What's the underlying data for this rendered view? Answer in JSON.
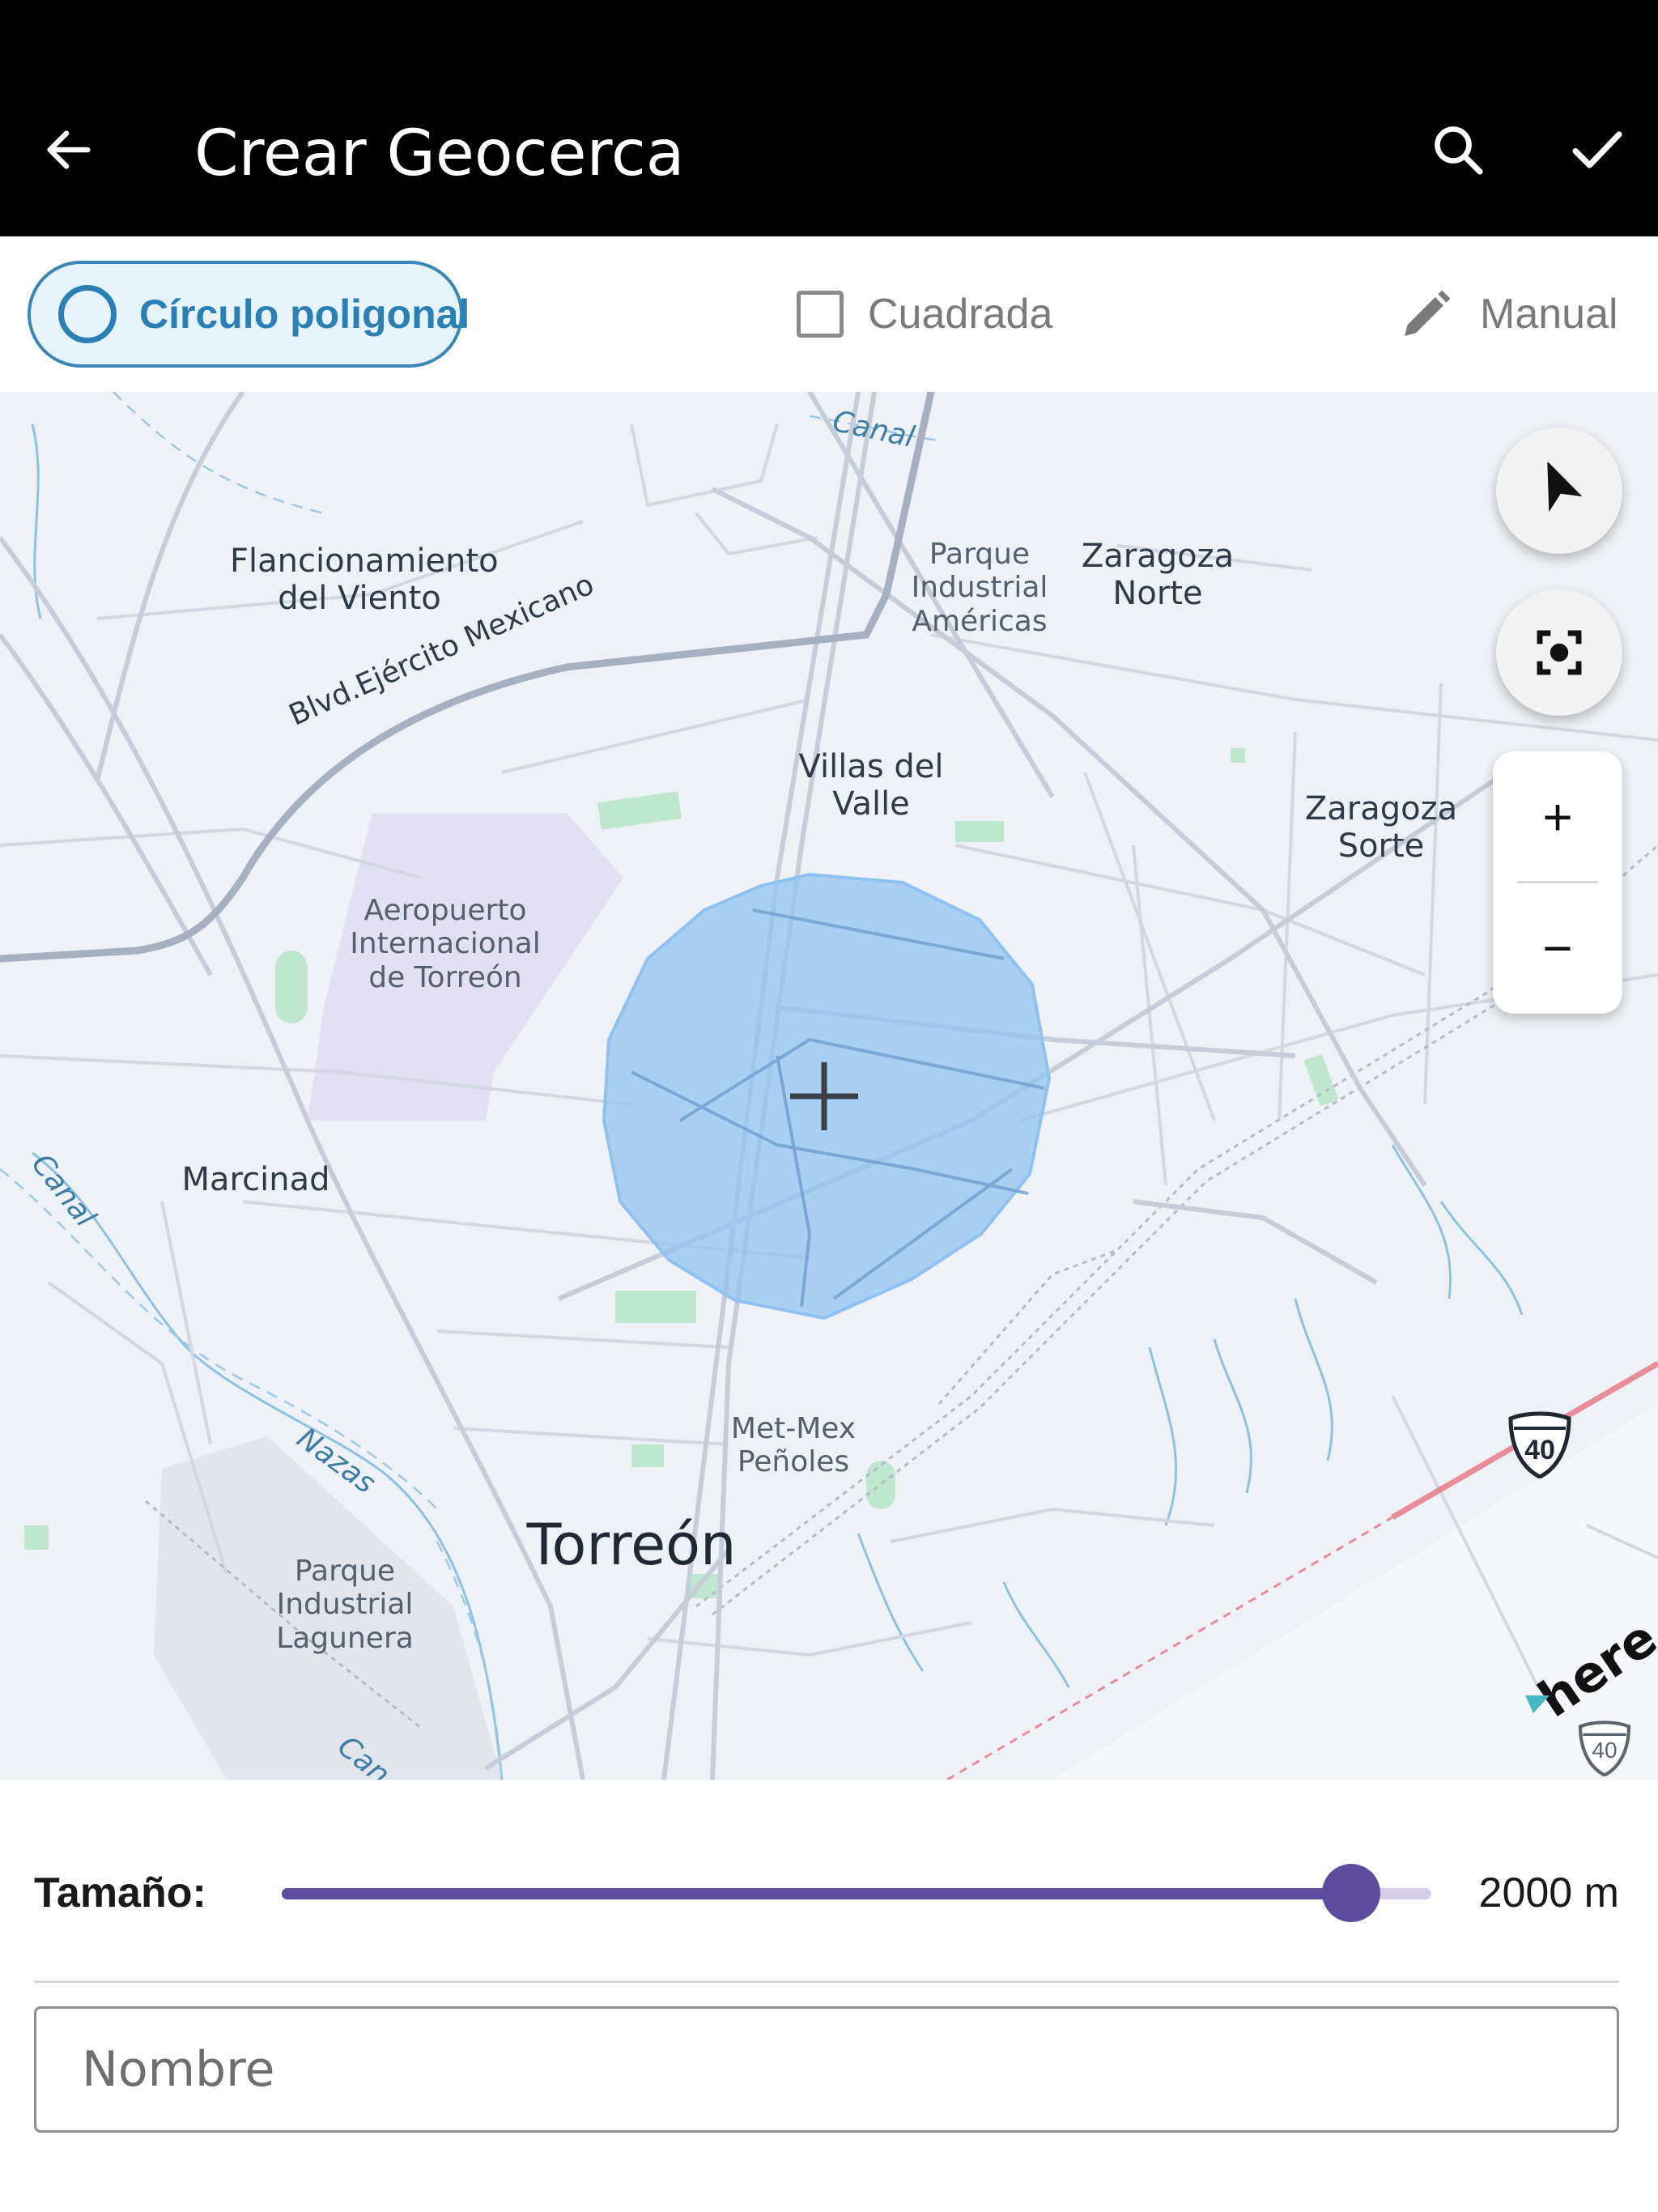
{
  "app_bar": {
    "title": "Crear Geocerca",
    "back_icon": "arrow-left-icon",
    "search_icon": "search-icon",
    "confirm_icon": "checkmark-icon"
  },
  "modes": {
    "circle": {
      "label": "Círculo poligonal",
      "selected": true
    },
    "square": {
      "label": "Cuadrada",
      "checked": false
    },
    "manual": {
      "label": "Manual",
      "icon": "pencil-icon"
    }
  },
  "map": {
    "labels": {
      "flancionamiento": "Flancionamiento\ndel Viento",
      "parque_americas": "Parque\nIndustrial\nAméricas",
      "zaragoza_norte": "Zaragoza\nNorte",
      "villas": "Villas del\nValle",
      "zaragoza_sorte": "Zaragoza\nSorte",
      "aeropuerto": "Aeropuerto\nInternacional\nde Torreón",
      "marcinad": "Marcinad",
      "metmex": "Met-Mex\nPeñoles",
      "torreon": "Torreón",
      "parque_lagunera": "Parque\nIndustrial\nLagunera",
      "boulevard": "Blvd.Ejército Mexicano",
      "canal_top": "Canal",
      "canal_left": "Canal",
      "canal_bottom": "Can",
      "nazas": "Nazas",
      "highway_40": "40",
      "highway_40_small": "40",
      "brand": "here"
    },
    "controls": {
      "locate_icon": "navigation-arrow-icon",
      "center_icon": "focus-target-icon",
      "zoom_in": "+",
      "zoom_out": "−"
    },
    "colors": {
      "geofence_fill": "#8fc2f2",
      "highway": "#e88c9a"
    }
  },
  "size": {
    "label": "Tamaño:",
    "value": 2000,
    "value_text": "2000 m",
    "fraction": 0.93
  },
  "name_input": {
    "placeholder": "Nombre",
    "value": ""
  },
  "accent": "#5e4c9c"
}
